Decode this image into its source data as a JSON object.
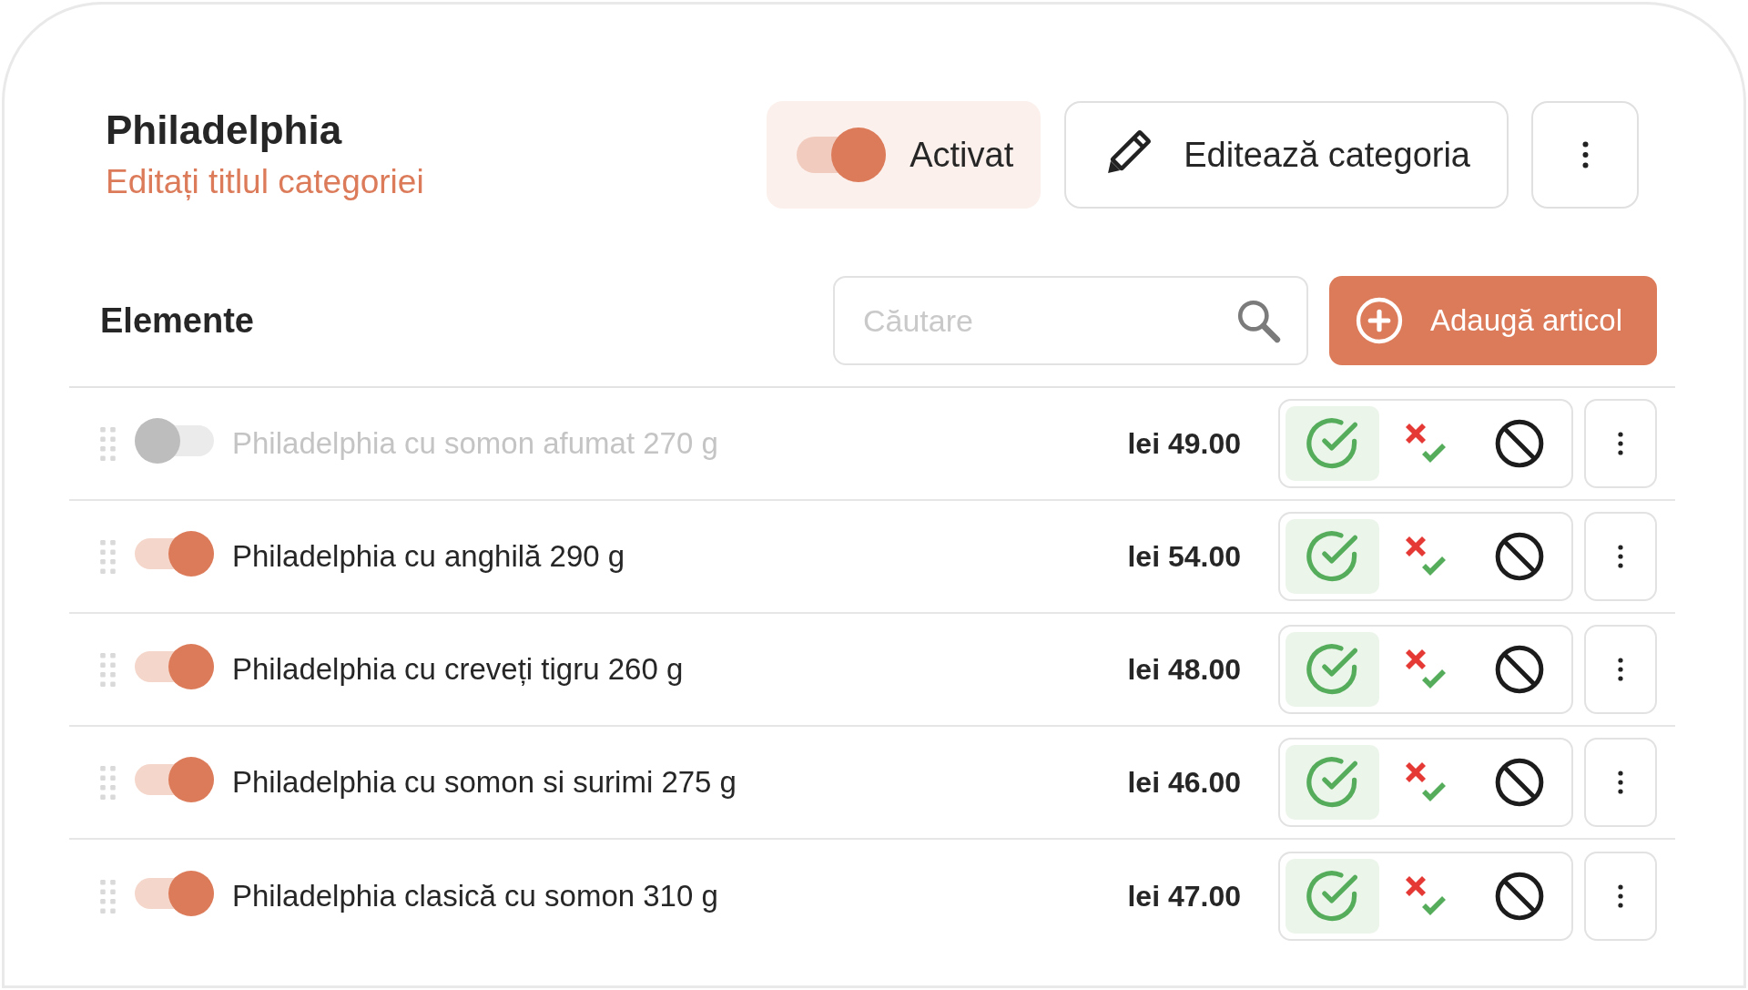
{
  "category": {
    "title": "Philadelphia",
    "edit_title_link": "Editați titlul categoriei",
    "status_toggle": {
      "on": true,
      "label": "Activat"
    },
    "edit_button": "Editează categoria"
  },
  "items_section": {
    "title": "Elemente",
    "search": {
      "placeholder": "Căutare"
    },
    "add_button": "Adaugă articol"
  },
  "items": [
    {
      "on": false,
      "name": "Philadelphia cu somon afumat 270 g",
      "price": "lei 49.00",
      "status_options": [
        {
          "kind": "check",
          "selected": true
        },
        {
          "kind": "crosscheck",
          "selected": false
        },
        {
          "kind": "ban",
          "selected": false
        }
      ]
    },
    {
      "on": true,
      "name": "Philadelphia cu anghilă 290 g",
      "price": "lei 54.00",
      "status_options": [
        {
          "kind": "check",
          "selected": true
        },
        {
          "kind": "crosscheck",
          "selected": false
        },
        {
          "kind": "ban",
          "selected": false
        }
      ]
    },
    {
      "on": true,
      "name": "Philadelphia cu creveți tigru 260 g",
      "price": "lei 48.00",
      "status_options": [
        {
          "kind": "check",
          "selected": true
        },
        {
          "kind": "crosscheck",
          "selected": false
        },
        {
          "kind": "ban",
          "selected": false
        }
      ]
    },
    {
      "on": true,
      "name": "Philadelphia cu somon si surimi 275 g",
      "price": "lei 46.00",
      "status_options": [
        {
          "kind": "check",
          "selected": true
        },
        {
          "kind": "crosscheck",
          "selected": false
        },
        {
          "kind": "ban",
          "selected": false
        }
      ]
    },
    {
      "on": true,
      "name": "Philadelphia clasică cu somon 310 g",
      "price": "lei 47.00",
      "status_options": [
        {
          "kind": "check",
          "selected": true
        },
        {
          "kind": "crosscheck",
          "selected": false
        },
        {
          "kind": "ban",
          "selected": false
        }
      ]
    }
  ]
}
